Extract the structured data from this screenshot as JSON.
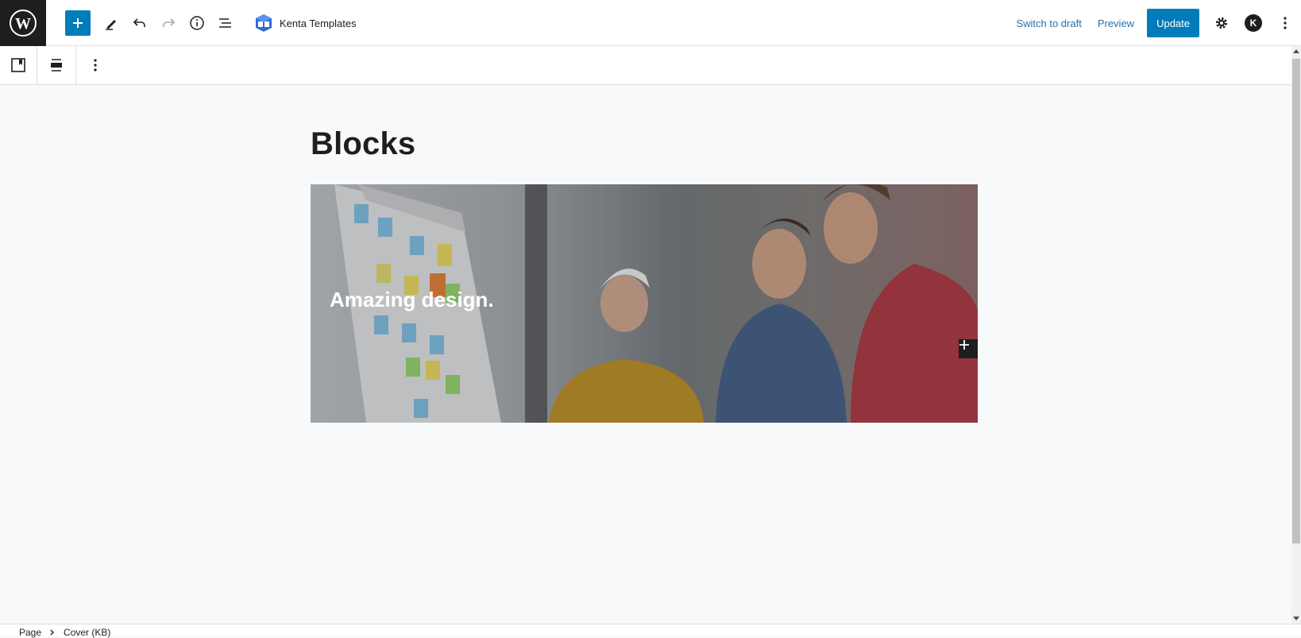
{
  "header": {
    "site_title": "Kenta Templates",
    "switch_to_draft": "Switch to draft",
    "preview": "Preview",
    "update": "Update",
    "avatar_letter": "K"
  },
  "icons": {
    "wordpress": "wordpress-logo-icon",
    "add": "plus-icon",
    "tools": "pencil-icon",
    "undo": "undo-icon",
    "redo": "redo-icon",
    "details": "info-icon",
    "list_view": "list-view-icon",
    "settings": "gear-icon",
    "options": "more-vertical-icon"
  },
  "block_toolbar": {
    "items": [
      "block-type-icon",
      "align-icon",
      "more-options-icon"
    ]
  },
  "content": {
    "title": "Blocks",
    "cover_heading": "Amazing design."
  },
  "footer": {
    "crumbs": [
      "Page",
      "Cover (KB)"
    ]
  },
  "colors": {
    "accent": "#007cba",
    "link": "#2271b1",
    "dark": "#1e1e1e"
  }
}
